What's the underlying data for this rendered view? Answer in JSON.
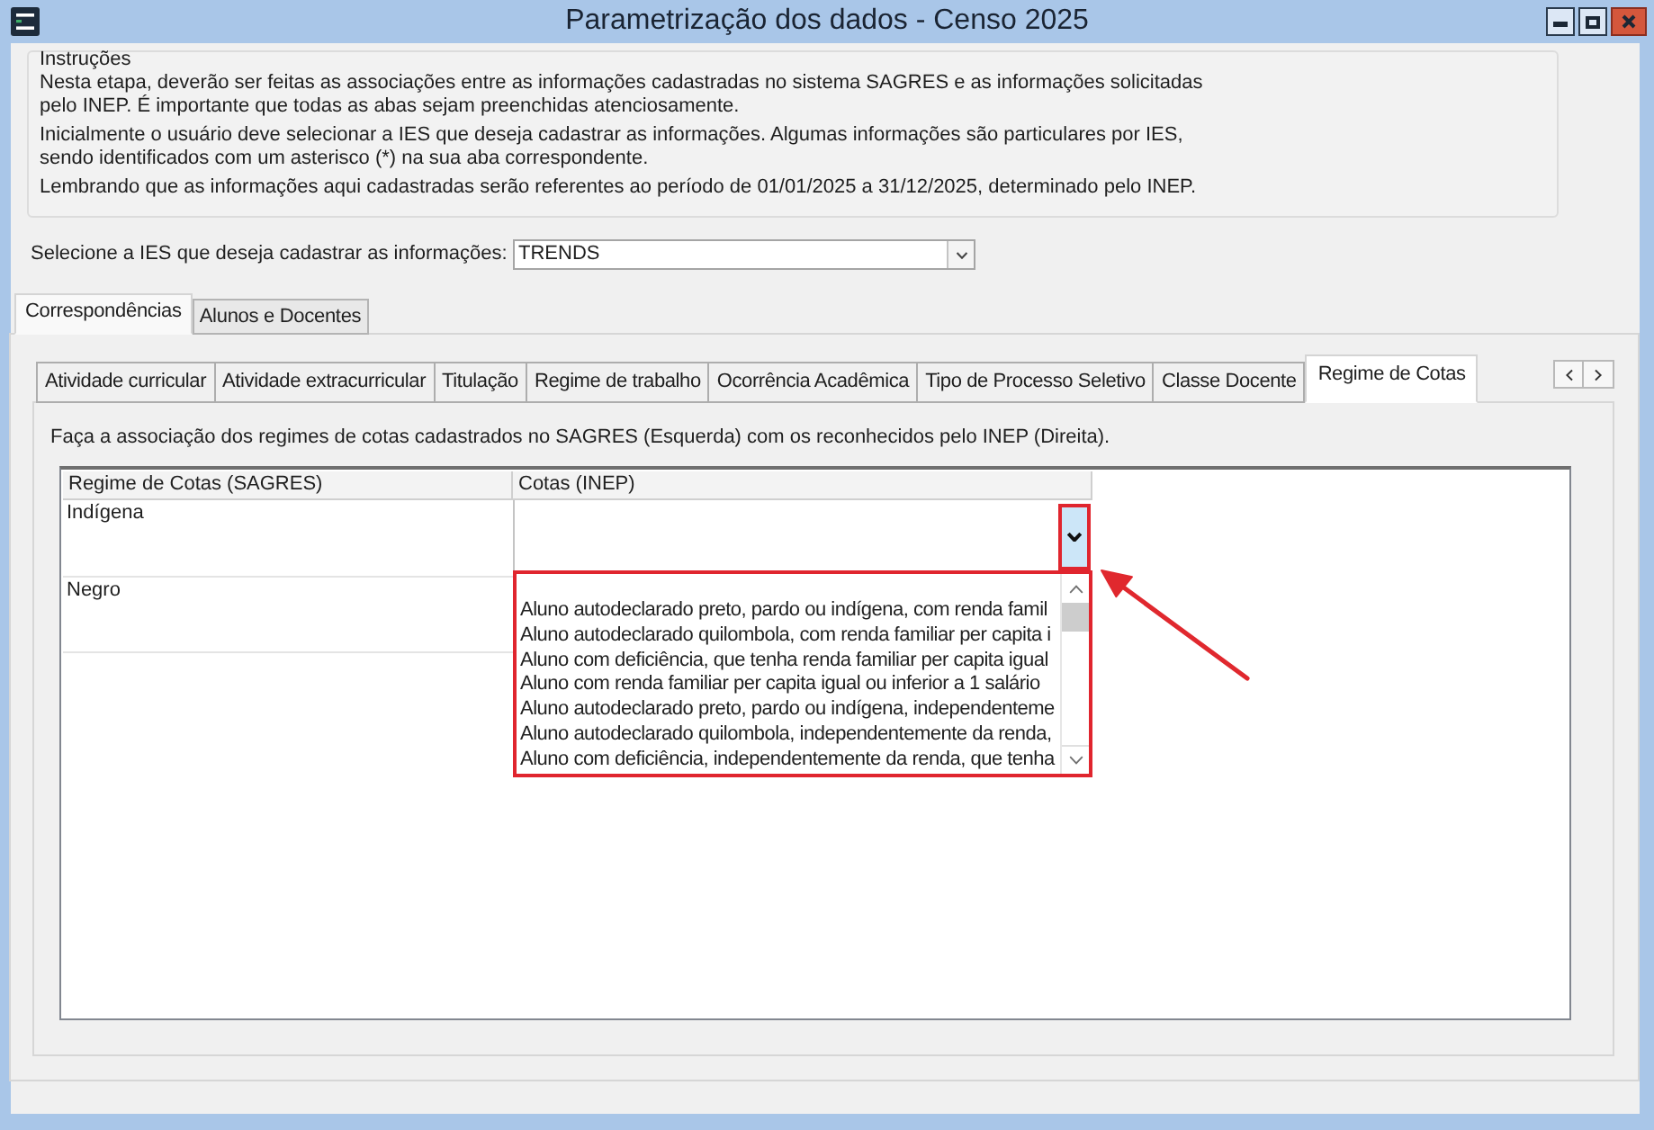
{
  "window": {
    "title": "Parametrização dos dados - Censo 2025"
  },
  "instructions": {
    "title": "Instruções",
    "paragraphs": [
      {
        "lines": [
          "Nesta etapa, deverão ser feitas as associações entre as informações cadastradas no sistema SAGRES e as informações solicitadas",
          "pelo INEP. É importante que todas as abas sejam preenchidas atenciosamente."
        ]
      },
      {
        "lines": [
          "Inicialmente o usuário deve selecionar a IES que deseja cadastrar as informações. Algumas informações são particulares por IES,",
          "sendo identificados com um asterisco (*) na sua aba correspondente."
        ]
      },
      {
        "lines": [
          "Lembrando que as informações aqui cadastradas serão referentes ao período de 01/01/2025 a 31/12/2025, determinado pelo INEP."
        ]
      }
    ]
  },
  "ies_selector": {
    "label": "Selecione a IES que deseja cadastrar as informações:",
    "value": "TRENDS"
  },
  "main_tabs": [
    {
      "label": "Correspondências",
      "selected": true
    },
    {
      "label": "Alunos e Docentes",
      "selected": false
    }
  ],
  "sub_tabs": [
    {
      "label": "Atividade curricular",
      "selected": false
    },
    {
      "label": "Atividade extracurricular",
      "selected": false
    },
    {
      "label": "Titulação",
      "selected": false
    },
    {
      "label": "Regime de trabalho",
      "selected": false
    },
    {
      "label": "Ocorrência Acadêmica",
      "selected": false
    },
    {
      "label": "Tipo de Processo Seletivo",
      "selected": false
    },
    {
      "label": "Classe Docente",
      "selected": false
    },
    {
      "label": "Regime de Cotas",
      "selected": true
    }
  ],
  "description": "Faça a associação dos regimes de cotas cadastrados no SAGRES (Esquerda) com os reconhecidos pelo INEP (Direita).",
  "table": {
    "columns": [
      "Regime de Cotas (SAGRES)",
      "Cotas (INEP)"
    ],
    "rows": [
      {
        "sagres": "Indígena",
        "expanded": true,
        "highlighted": true,
        "options": [
          {
            "label": "Aluno autodeclarado preto, pardo ou indígena, com renda famil",
            "selected": false
          },
          {
            "label": "Aluno autodeclarado quilombola, com renda familiar per capita i",
            "selected": false
          },
          {
            "label": "Aluno com deficiência, que tenha renda familiar per capita igual",
            "selected": false
          },
          {
            "label": "Aluno com renda familiar per capita igual ou inferior a 1 salário",
            "selected": false
          },
          {
            "label": "Aluno autodeclarado preto, pardo ou indígena, independenteme",
            "selected": false
          },
          {
            "label": "Aluno autodeclarado quilombola, independentemente da renda,",
            "selected": false
          },
          {
            "label": "Aluno com deficiência, independentemente da renda, que tenha",
            "selected": false
          }
        ]
      },
      {
        "sagres": "Negro"
      }
    ]
  }
}
